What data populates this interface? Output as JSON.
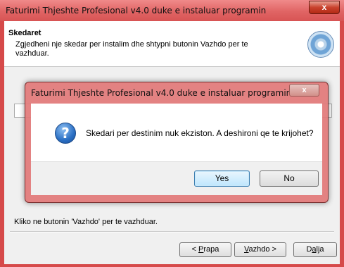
{
  "window": {
    "title": "Faturimi Thjeshte Profesional v4.0 duke e instaluar programin",
    "close_label": "x"
  },
  "header": {
    "title": "Skedaret",
    "subtitle": "Zgjedheni nje skedar per instalim dhe shtypni butonin Vazhdo per te vazhduar.",
    "icon": "cd-icon"
  },
  "body": {
    "hint": "Kliko ne butonin 'Vazhdo' per te vazhduar."
  },
  "buttons": {
    "back": {
      "prefix": "< ",
      "accel": "P",
      "rest": "rapa"
    },
    "next": {
      "accel": "V",
      "rest": "azhdo >"
    },
    "exit": {
      "prefix": "D",
      "accel": "a",
      "rest": "lja"
    }
  },
  "dialog": {
    "title": "Faturimi Thjeshte Profesional v4.0 duke e instaluar programin",
    "close_label": "x",
    "icon": "question-icon",
    "icon_glyph": "?",
    "message": "Skedari per destinim nuk ekziston. A deshironi qe te krijohet?",
    "yes_label": "Yes",
    "no_label": "No"
  }
}
